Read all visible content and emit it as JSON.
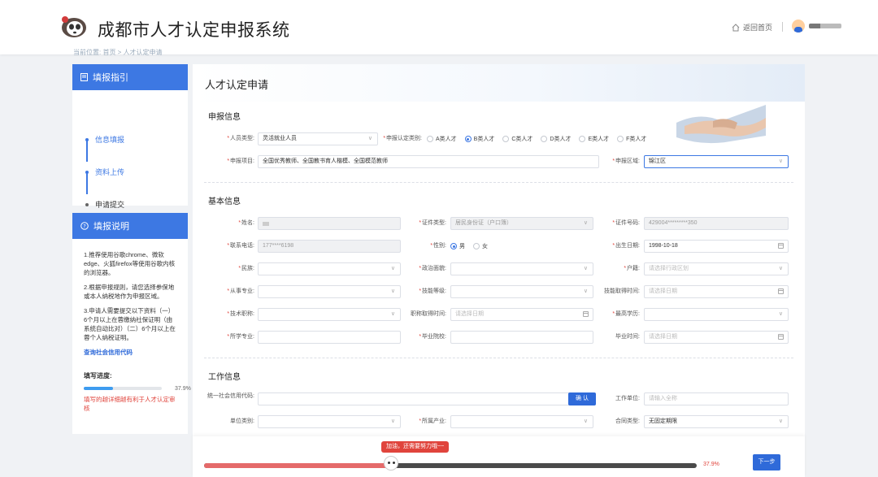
{
  "header": {
    "app_title": "成都市人才认定申报系统",
    "home_link": "返回首页"
  },
  "breadcrumb": "当前位置: 首页 > 人才认定申请",
  "sidebar": {
    "guide_title": "填报指引",
    "steps": [
      {
        "label": "信息填报",
        "active": true
      },
      {
        "label": "资料上传",
        "active": true
      },
      {
        "label": "申请提交",
        "active": false
      }
    ],
    "notes_title": "填报说明",
    "notes": [
      "1.推荐使用谷歌chrome、微软edge、火狐firefox等使用谷歌内核的浏览器。",
      "2.根据申报规则，请您选择参保地或本人纳税地作为申报区域。",
      "3.申请人需要提交以下资料（一）6个月以上在蓉缴纳社保证明（由系统自动比对）（二）6个月以上在蓉个人纳税证明。"
    ],
    "credit_link": "查询社会信用代码",
    "progress_label": "填写进度:",
    "progress_value": 0.379,
    "progress_text": "37.9%",
    "progress_note": "填写的越详细越有利于人才认定审核"
  },
  "main": {
    "title": "人才认定申请",
    "sections": {
      "apply": "申报信息",
      "basic": "基本信息",
      "work": "工作信息"
    },
    "fields": {
      "person_type_label": "人员类型:",
      "person_type_value": "灵活就业人员",
      "category_label": "申报认定类别:",
      "categories": [
        {
          "label": "A类人才",
          "checked": false
        },
        {
          "label": "B类人才",
          "checked": true
        },
        {
          "label": "C类人才",
          "checked": false
        },
        {
          "label": "D类人才",
          "checked": false
        },
        {
          "label": "E类人才",
          "checked": false
        },
        {
          "label": "F类人才",
          "checked": false
        }
      ],
      "project_label": "申报项目:",
      "project_value": "全国优秀教师、全国教书育人楷模、全国模范教师",
      "region_label": "申报区域:",
      "region_value": "锦江区",
      "name_label": "姓名:",
      "id_type_label": "证件类型:",
      "id_type_value": "居民身份证（户口簿）",
      "id_no_label": "证件号码:",
      "id_no_value": "429004*********350",
      "phone_label": "联系电话:",
      "phone_value": "177****6198",
      "gender_label": "性别:",
      "gender_male": "男",
      "gender_female": "女",
      "birth_label": "出生日期:",
      "birth_value": "1998-10-18",
      "ethnic_label": "民族:",
      "politics_label": "政治面貌:",
      "hukou_label": "户籍:",
      "hukou_ph": "请选择行政区划",
      "major_label": "从事专业:",
      "skill_label": "技能等级:",
      "skill_time_label": "技能取得时间:",
      "skill_time_ph": "请选择日期",
      "title_label": "技术职称:",
      "title_time_label": "职称取得时间:",
      "title_time_ph": "请选择日期",
      "degree_label": "最高学历:",
      "study_major_label": "所学专业:",
      "school_label": "毕业院校:",
      "grad_time_label": "毕业时间:",
      "grad_time_ph": "请选择日期",
      "credit_code_label": "统一社会信用代码:",
      "confirm": "确 认",
      "employer_label": "工作单位:",
      "employer_ph": "请输入全称",
      "unit_type_label": "单位类别:",
      "industry_label": "所属产业:",
      "contract_label": "合同类型:",
      "contract_value": "无固定期限"
    }
  },
  "bottom": {
    "encourage": "加油，还需要努力哦~~",
    "progress_value": 0.379,
    "progress_text": "37.9%",
    "next": "下一步"
  },
  "colors": {
    "accent": "#3d78e3",
    "required": "#e0443c",
    "progress_fill": "#e56a6a"
  }
}
